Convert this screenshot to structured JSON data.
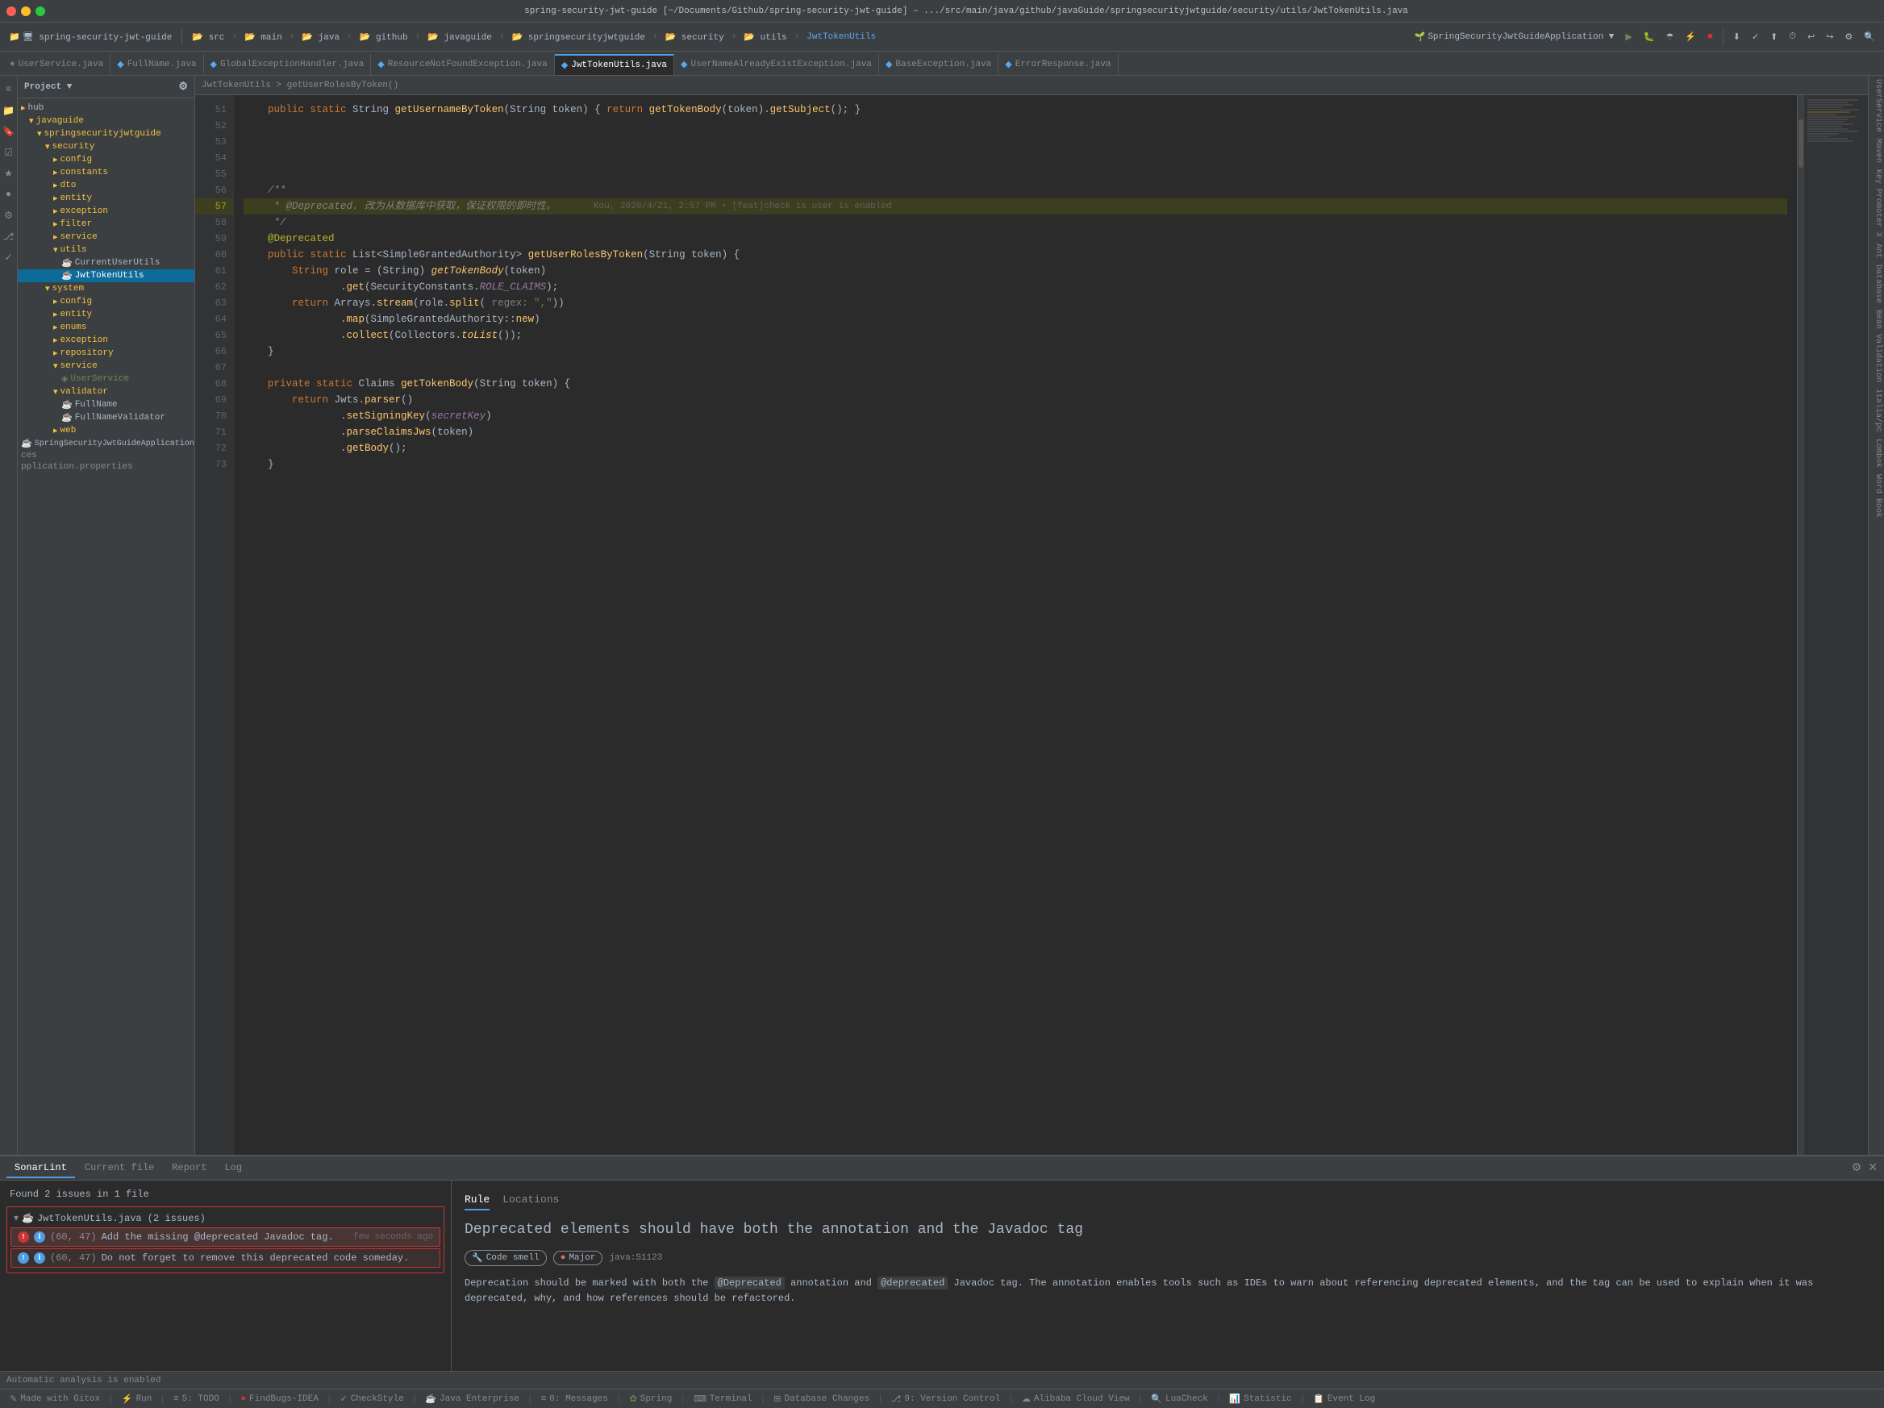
{
  "title_bar": {
    "text": "spring-security-jwt-guide [~/Documents/Github/spring-security-jwt-guide] – .../src/main/java/github/javaGuide/springsecurityjwtguide/security/utils/JwtTokenUtils.java"
  },
  "toolbar": {
    "project_label": "Project",
    "breadcrumb_items": [
      "src",
      "main",
      "java",
      "github",
      "javaGuide",
      "springsecurityjwtguide",
      "security",
      "utils"
    ],
    "file_name": "JwtTokenUtils",
    "app_name": "SpringSecurityJwtGuideApplication",
    "run_config": "SpringSecurityJwtGuideApplication ▼"
  },
  "file_tabs": [
    {
      "label": "UserService.java",
      "active": false,
      "dot": false
    },
    {
      "label": "FullName.java",
      "active": false,
      "dot": false
    },
    {
      "label": "GlobalExceptionHandler.java",
      "active": false,
      "dot": false
    },
    {
      "label": "ResourceNotFoundException.java",
      "active": false,
      "dot": false
    },
    {
      "label": "JwtTokenUtils.java",
      "active": true,
      "dot": false
    },
    {
      "label": "UserNameAlreadyExistException.java",
      "active": false,
      "dot": false
    },
    {
      "label": "BaseException.java",
      "active": false,
      "dot": false
    },
    {
      "label": "ErrorResponse.java",
      "active": false,
      "dot": false
    }
  ],
  "sidebar": {
    "header": "Project ▼",
    "tree": [
      {
        "label": "hub",
        "indent": 0,
        "type": "folder",
        "expanded": false
      },
      {
        "label": "javaguide",
        "indent": 1,
        "type": "folder",
        "expanded": true
      },
      {
        "label": "springsecurityjwtguide",
        "indent": 2,
        "type": "folder",
        "expanded": true
      },
      {
        "label": "security",
        "indent": 3,
        "type": "folder",
        "expanded": true
      },
      {
        "label": "config",
        "indent": 4,
        "type": "folder",
        "expanded": false
      },
      {
        "label": "constants",
        "indent": 4,
        "type": "folder",
        "expanded": false
      },
      {
        "label": "dto",
        "indent": 4,
        "type": "folder",
        "expanded": false
      },
      {
        "label": "entity",
        "indent": 4,
        "type": "folder",
        "expanded": false
      },
      {
        "label": "exception",
        "indent": 4,
        "type": "folder",
        "expanded": false
      },
      {
        "label": "filter",
        "indent": 4,
        "type": "folder",
        "expanded": false
      },
      {
        "label": "service",
        "indent": 4,
        "type": "folder",
        "expanded": false
      },
      {
        "label": "utils",
        "indent": 4,
        "type": "folder",
        "expanded": true
      },
      {
        "label": "CurrentUserUtils",
        "indent": 5,
        "type": "java",
        "expanded": false
      },
      {
        "label": "JwtTokenUtils",
        "indent": 5,
        "type": "java",
        "expanded": false,
        "selected": true
      },
      {
        "label": "system",
        "indent": 3,
        "type": "folder",
        "expanded": true
      },
      {
        "label": "config",
        "indent": 4,
        "type": "folder",
        "expanded": false
      },
      {
        "label": "entity",
        "indent": 4,
        "type": "folder",
        "expanded": false
      },
      {
        "label": "enums",
        "indent": 4,
        "type": "folder",
        "expanded": false
      },
      {
        "label": "exception",
        "indent": 4,
        "type": "folder",
        "expanded": false
      },
      {
        "label": "repository",
        "indent": 4,
        "type": "folder",
        "expanded": false
      },
      {
        "label": "service",
        "indent": 4,
        "type": "folder",
        "expanded": true
      },
      {
        "label": "UserService",
        "indent": 5,
        "type": "java-interface",
        "expanded": false
      },
      {
        "label": "validator",
        "indent": 4,
        "type": "folder",
        "expanded": true
      },
      {
        "label": "FullName",
        "indent": 5,
        "type": "java",
        "expanded": false
      },
      {
        "label": "FullNameValidator",
        "indent": 5,
        "type": "java",
        "expanded": false
      },
      {
        "label": "web",
        "indent": 4,
        "type": "folder",
        "expanded": false
      },
      {
        "label": "SpringSecurityJwtGuideApplication",
        "indent": 4,
        "type": "java",
        "expanded": false
      }
    ],
    "extra_items": [
      {
        "label": "ces",
        "type": "text"
      },
      {
        "label": "pplication.properties",
        "type": "text"
      }
    ]
  },
  "code_editor": {
    "breadcrumb": "JwtTokenUtils > getUserRolesByToken()",
    "lines": [
      {
        "num": 51,
        "content": "    public static String getUsernameByToken(String token) { return getTokenBody(token).getSubject(); }"
      },
      {
        "num": 54,
        "content": ""
      },
      {
        "num": 55,
        "content": ""
      },
      {
        "num": 56,
        "content": "    /**"
      },
      {
        "num": 57,
        "content": "     * @Deprecated. 改为从数据库中获取，保证权限的即时性。",
        "highlight": true,
        "commit": "Kou, 2020/4/21, 2:57 PM • [feat]check is user is enabled"
      },
      {
        "num": 58,
        "content": "     */"
      },
      {
        "num": 59,
        "content": "    @Deprecated"
      },
      {
        "num": 60,
        "content": "    public static List<SimpleGrantedAuthority> getUserRolesByToken(String token) {"
      },
      {
        "num": 61,
        "content": "        String role = (String) getTokenBody(token)"
      },
      {
        "num": 62,
        "content": "                .get(SecurityConstants.ROLE_CLAIMS);"
      },
      {
        "num": 63,
        "content": "        return Arrays.stream(role.split( regex: \",\"))"
      },
      {
        "num": 64,
        "content": "                .map(SimpleGrantedAuthority::new)"
      },
      {
        "num": 65,
        "content": "                .collect(Collectors.toList());"
      },
      {
        "num": 66,
        "content": "    }"
      },
      {
        "num": 67,
        "content": ""
      },
      {
        "num": 68,
        "content": "    private static Claims getTokenBody(String token) {"
      },
      {
        "num": 69,
        "content": "        return Jwts.parser()"
      },
      {
        "num": 70,
        "content": "                .setSigningKey(secretKey)"
      },
      {
        "num": 71,
        "content": "                .parseClaimsJws(token)"
      },
      {
        "num": 72,
        "content": "                .getBody();"
      },
      {
        "num": 73,
        "content": "    }"
      }
    ]
  },
  "bottom_panel": {
    "tabs": [
      {
        "label": "SonarLint",
        "active": true
      },
      {
        "label": "Current file",
        "active": false
      },
      {
        "label": "Report",
        "active": false
      },
      {
        "label": "Log",
        "active": false
      }
    ],
    "issues_header": "Found 2 issues in 1 file",
    "issue_file": "JwtTokenUtils.java (2 issues)",
    "issues": [
      {
        "id": "issue-1",
        "coords": "(60, 47)",
        "text": "Add the missing @deprecated Javadoc tag.",
        "time": "few seconds ago",
        "type": "error"
      },
      {
        "id": "issue-2",
        "coords": "(60, 47)",
        "text": "Do not forget to remove this deprecated code someday.",
        "time": "",
        "type": "info"
      }
    ],
    "rule_tabs": [
      {
        "label": "Rule",
        "active": true
      },
      {
        "label": "Locations",
        "active": false
      }
    ],
    "rule_title": "Deprecated elements should have both the annotation and the Javadoc tag",
    "badges": [
      {
        "label": "Code smell",
        "type": "smell"
      },
      {
        "label": "Major",
        "type": "major"
      },
      {
        "label": "java:S1123",
        "type": "rule-id"
      }
    ],
    "rule_description": "Deprecation should be marked with both the @Deprecated annotation and @deprecated Javadoc tag. The annotation enables tools such as IDEs to warn about referencing deprecated elements, and the tag can be used to explain when it was deprecated, why, and how references should be refactored."
  },
  "status_bar": {
    "items": [
      {
        "label": "✎ Made with Gitox",
        "type": "normal"
      },
      {
        "label": "⚡ Run",
        "type": "normal"
      },
      {
        "label": "≡ 5: TODO",
        "type": "normal"
      },
      {
        "label": "● FindBugs-IDEA",
        "type": "red"
      },
      {
        "label": "✓ CheckStyle",
        "type": "normal"
      },
      {
        "label": "☕ Java Enterprise",
        "type": "normal"
      },
      {
        "label": "≡ 0: Messages",
        "type": "normal"
      },
      {
        "label": "✿ Spring",
        "type": "green"
      },
      {
        "label": "⌨ Terminal",
        "type": "normal"
      },
      {
        "label": "⊞ Database Changes",
        "type": "normal"
      },
      {
        "label": "⎇ 9: Version Control",
        "type": "normal"
      },
      {
        "label": "☁ Alibaba Cloud View",
        "type": "normal"
      },
      {
        "label": "🔍 LuaCheck",
        "type": "normal"
      },
      {
        "label": "📊 Statistic",
        "type": "normal"
      },
      {
        "label": "Event Log",
        "type": "normal"
      }
    ],
    "bottom_status": "Automatic analysis is enabled"
  },
  "right_sidebar_labels": [
    "UserService",
    "Maven",
    "Key Promoter X",
    "Ant",
    "Database",
    "Bean Validation",
    "italia/pc",
    "Lombok",
    "Word Book"
  ],
  "minimap_lines": 40
}
